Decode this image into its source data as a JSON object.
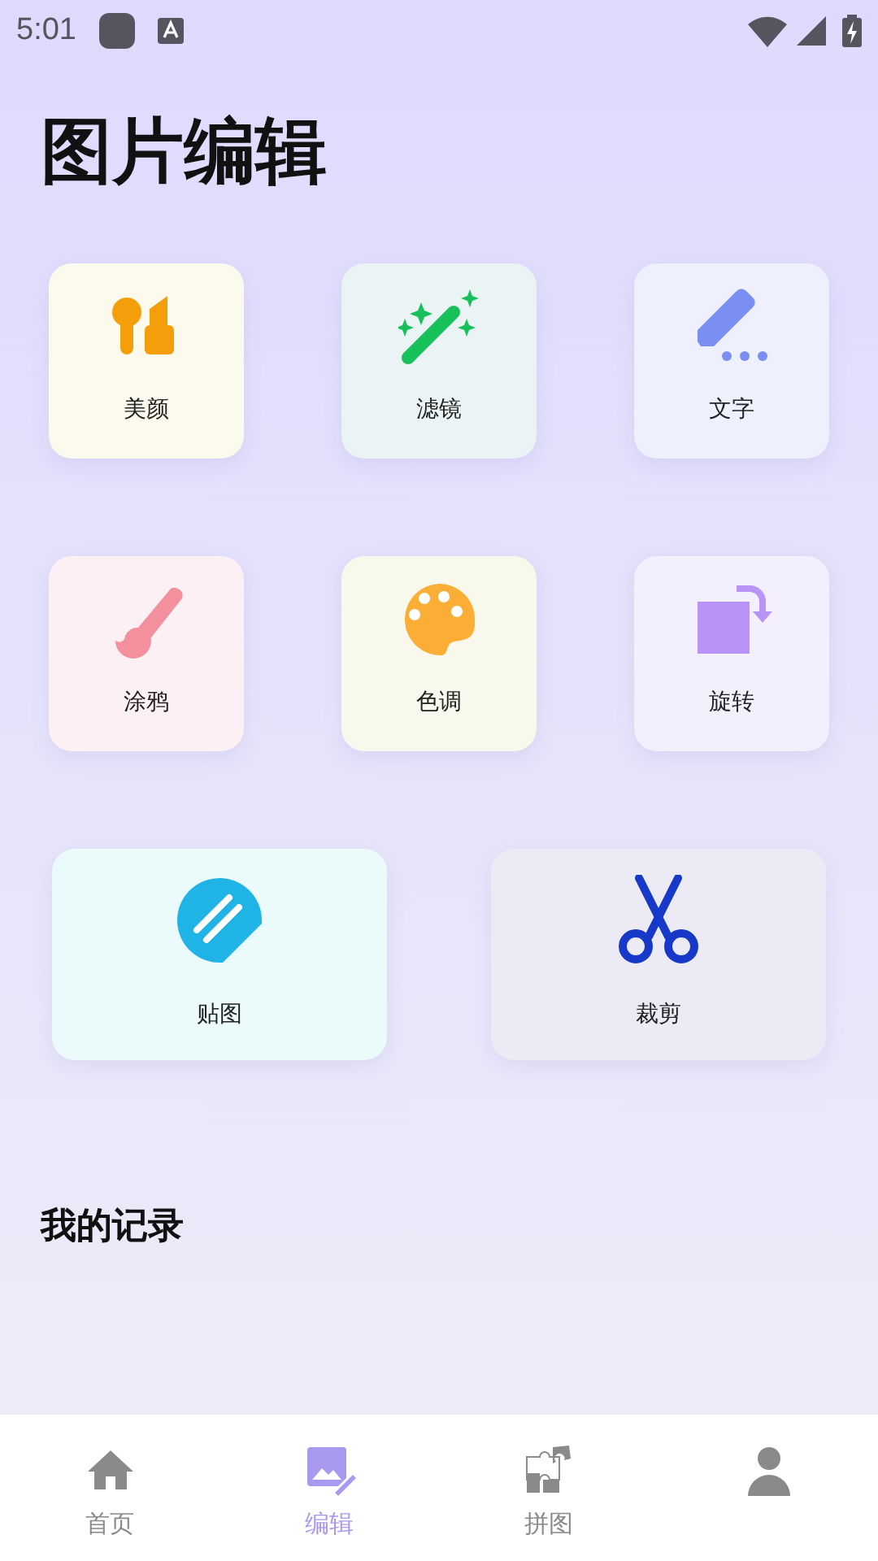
{
  "status_bar": {
    "time": "5:01"
  },
  "title": "图片编辑",
  "tools": [
    {
      "label": "美颜",
      "kind": "beauty",
      "color": "#fcfaec"
    },
    {
      "label": "滤镜",
      "kind": "filter",
      "color": "#eaf4f4"
    },
    {
      "label": "文字",
      "kind": "text",
      "color": "#eef0fd"
    },
    {
      "label": "涂鸦",
      "kind": "doodle",
      "color": "#fcf0f4"
    },
    {
      "label": "色调",
      "kind": "tone",
      "color": "#f8f9ec"
    },
    {
      "label": "旋转",
      "kind": "rotate",
      "color": "#f3effd"
    }
  ],
  "wide_tools": [
    {
      "label": "贴图",
      "kind": "sticker",
      "color": "#ebfafb"
    },
    {
      "label": "裁剪",
      "kind": "crop",
      "color": "#ecebf5"
    }
  ],
  "records_heading": "我的记录",
  "nav": [
    {
      "label": "首页",
      "kind": "home",
      "selected": false
    },
    {
      "label": "编辑",
      "kind": "edit",
      "selected": true
    },
    {
      "label": "拼图",
      "kind": "puzzle",
      "selected": false
    },
    {
      "kind": "profile",
      "selected": false
    }
  ]
}
